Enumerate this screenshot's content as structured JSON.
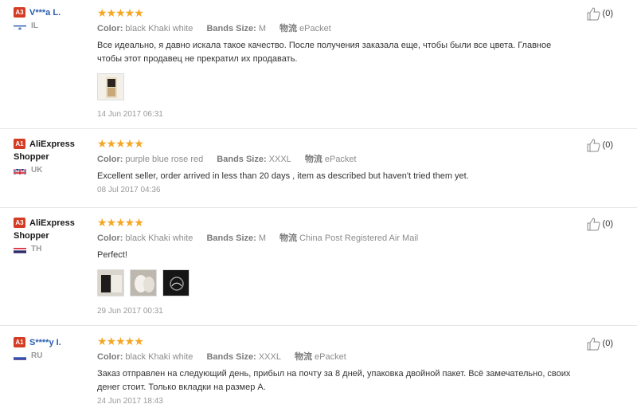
{
  "field_labels": {
    "color": "Color:",
    "size": "Bands Size:",
    "shipping_prefix": "物流"
  },
  "reviews": [
    {
      "badge": "A3",
      "name": "V***a L.",
      "name_is_link": true,
      "country_code": "IL",
      "flag": "flag-israel-icon",
      "stars": "★★★★★",
      "rating": 5,
      "color": "black Khaki white",
      "size": "M",
      "shipping": "ePacket",
      "text": "Все идеально, я давно искала такое качество. После получения заказала еще, чтобы были все цвета. Главное чтобы этот продавец не прекратил их продавать.",
      "date": "14 Jun 2017 06:31",
      "likes": "(0)",
      "photos": 1
    },
    {
      "badge": "A1",
      "name": "AliExpress Shopper",
      "name_is_link": false,
      "country_code": "UK",
      "flag": "flag-uk-icon",
      "stars": "★★★★★",
      "rating": 5,
      "color": "purple blue rose red",
      "size": "XXXL",
      "shipping": "ePacket",
      "text": "Excellent seller, order arrived in less than 20 days , item as described but haven't tried them yet.",
      "date": "08 Jul 2017 04:36",
      "likes": "(0)",
      "photos": 0
    },
    {
      "badge": "A3",
      "name": "AliExpress Shopper",
      "name_is_link": false,
      "country_code": "TH",
      "flag": "flag-thailand-icon",
      "stars": "★★★★★",
      "rating": 5,
      "color": "black Khaki white",
      "size": "M",
      "shipping": "China Post Registered Air Mail",
      "text": "Perfect!",
      "date": "29 Jun 2017 00:31",
      "likes": "(0)",
      "photos": 3
    },
    {
      "badge": "A1",
      "name": "S****y I.",
      "name_is_link": true,
      "country_code": "RU",
      "flag": "flag-russia-icon",
      "stars": "★★★★★",
      "rating": 5,
      "color": "black Khaki white",
      "size": "XXXL",
      "shipping": "ePacket",
      "text": "Заказ отправлен на следующий день, прибыл на почту за 8 дней, упаковка двойной пакет. Всё замечательно, своих денег стоит. Только вкладки на размер А.",
      "date": "24 Jun 2017 18:43",
      "likes": "(0)",
      "photos": 0
    }
  ],
  "colors": {
    "badge": "#d43c23",
    "stars": "#f5a623",
    "link_name": "#2a5db0"
  }
}
